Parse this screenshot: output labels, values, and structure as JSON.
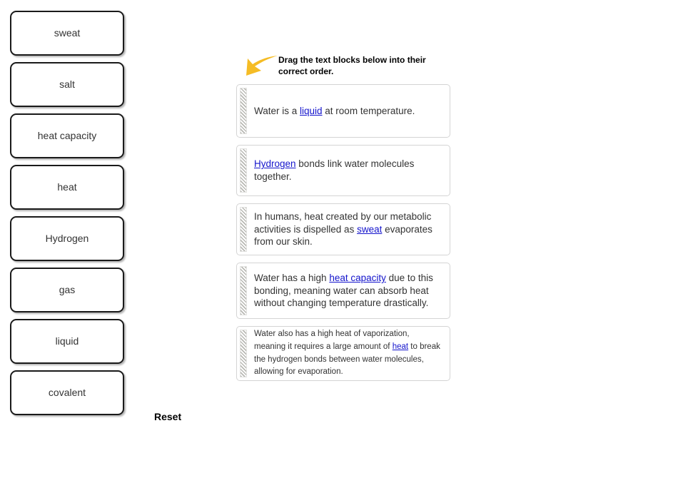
{
  "word_bank": {
    "items": [
      {
        "label": "sweat"
      },
      {
        "label": "salt"
      },
      {
        "label": "heat capacity"
      },
      {
        "label": "heat"
      },
      {
        "label": "Hydrogen"
      },
      {
        "label": "gas"
      },
      {
        "label": "liquid"
      },
      {
        "label": "covalent"
      }
    ]
  },
  "controls": {
    "reset_label": "Reset"
  },
  "instruction": {
    "text": "Drag the text blocks below into their correct order.",
    "arrow_icon": "curved-arrow-down-left-icon",
    "arrow_color": "#F5BC25"
  },
  "statements": [
    {
      "id": 1,
      "handle_icon": "drag-handle-icon",
      "segments": [
        {
          "text": "Water is a ",
          "link": false
        },
        {
          "text": "liquid",
          "link": true
        },
        {
          "text": " at room temperature.",
          "link": false
        }
      ],
      "plain_text": "Water is a liquid at room temperature."
    },
    {
      "id": 2,
      "handle_icon": "drag-handle-icon",
      "segments": [
        {
          "text": "Hydrogen",
          "link": true
        },
        {
          "text": " bonds link water molecules together.",
          "link": false
        }
      ],
      "plain_text": "Hydrogen bonds link water molecules together."
    },
    {
      "id": 3,
      "handle_icon": "drag-handle-icon",
      "segments": [
        {
          "text": "In humans, heat created by our metabolic activities is dispelled as ",
          "link": false
        },
        {
          "text": "sweat",
          "link": true
        },
        {
          "text": " evaporates from our skin.",
          "link": false
        }
      ],
      "plain_text": "In humans, heat created by our metabolic activities is dispelled as sweat evaporates from our skin."
    },
    {
      "id": 4,
      "handle_icon": "drag-handle-icon",
      "segments": [
        {
          "text": "Water has a high ",
          "link": false
        },
        {
          "text": "heat capacity",
          "link": true
        },
        {
          "text": " due to this bonding, meaning water can absorb heat without changing temperature drastically.",
          "link": false
        }
      ],
      "plain_text": "Water has a high heat capacity due to this bonding, meaning water can absorb heat without changing temperature drastically."
    },
    {
      "id": 5,
      "compact": true,
      "handle_icon": "drag-handle-icon",
      "segments": [
        {
          "text": "Water also has a high heat of vaporization, meaning it requires a large amount of ",
          "link": false
        },
        {
          "text": "heat",
          "link": true
        },
        {
          "text": " to break the hydrogen bonds between water molecules, allowing for evaporation.",
          "link": false
        }
      ],
      "plain_text": "Water also has a high heat of vaporization, meaning it requires a large amount of heat to break the hydrogen bonds between water molecules, allowing for evaporation."
    }
  ],
  "colors": {
    "tile_border": "#1A1A1A",
    "tile_text": "#333333",
    "link": "#1414CC",
    "block_border": "#D4D4D4"
  }
}
